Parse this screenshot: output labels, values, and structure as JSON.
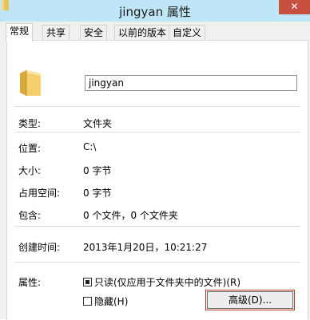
{
  "window": {
    "title": "jingyan 属性",
    "close_symbol": "✕"
  },
  "tabs": [
    {
      "label": "常规",
      "active": true
    },
    {
      "label": "共享"
    },
    {
      "label": "安全"
    },
    {
      "label": "以前的版本"
    },
    {
      "label": "自定义"
    }
  ],
  "general": {
    "name_value": "jingyan",
    "type_label": "类型:",
    "type_value": "文件夹",
    "location_label": "位置:",
    "location_value": "C:\\",
    "size_label": "大小:",
    "size_value": "0 字节",
    "size_on_disk_label": "占用空间:",
    "size_on_disk_value": "0 字节",
    "contains_label": "包含:",
    "contains_value": "0 个文件，0 个文件夹",
    "created_label": "创建时间:",
    "created_value": "2013年1月20日，10:21:27",
    "attributes_label": "属性:",
    "readonly_label": "只读(仅应用于文件夹中的文件)(R)",
    "readonly_state": "indeterminate",
    "hidden_label": "隐藏(H)",
    "hidden_checked": false,
    "advanced_label": "高级(D)..."
  },
  "colors": {
    "titlebar": "#bfe6f7",
    "close_button": "#c7503e",
    "folder": "#e8c25a",
    "highlight_border": "#c0392b"
  }
}
